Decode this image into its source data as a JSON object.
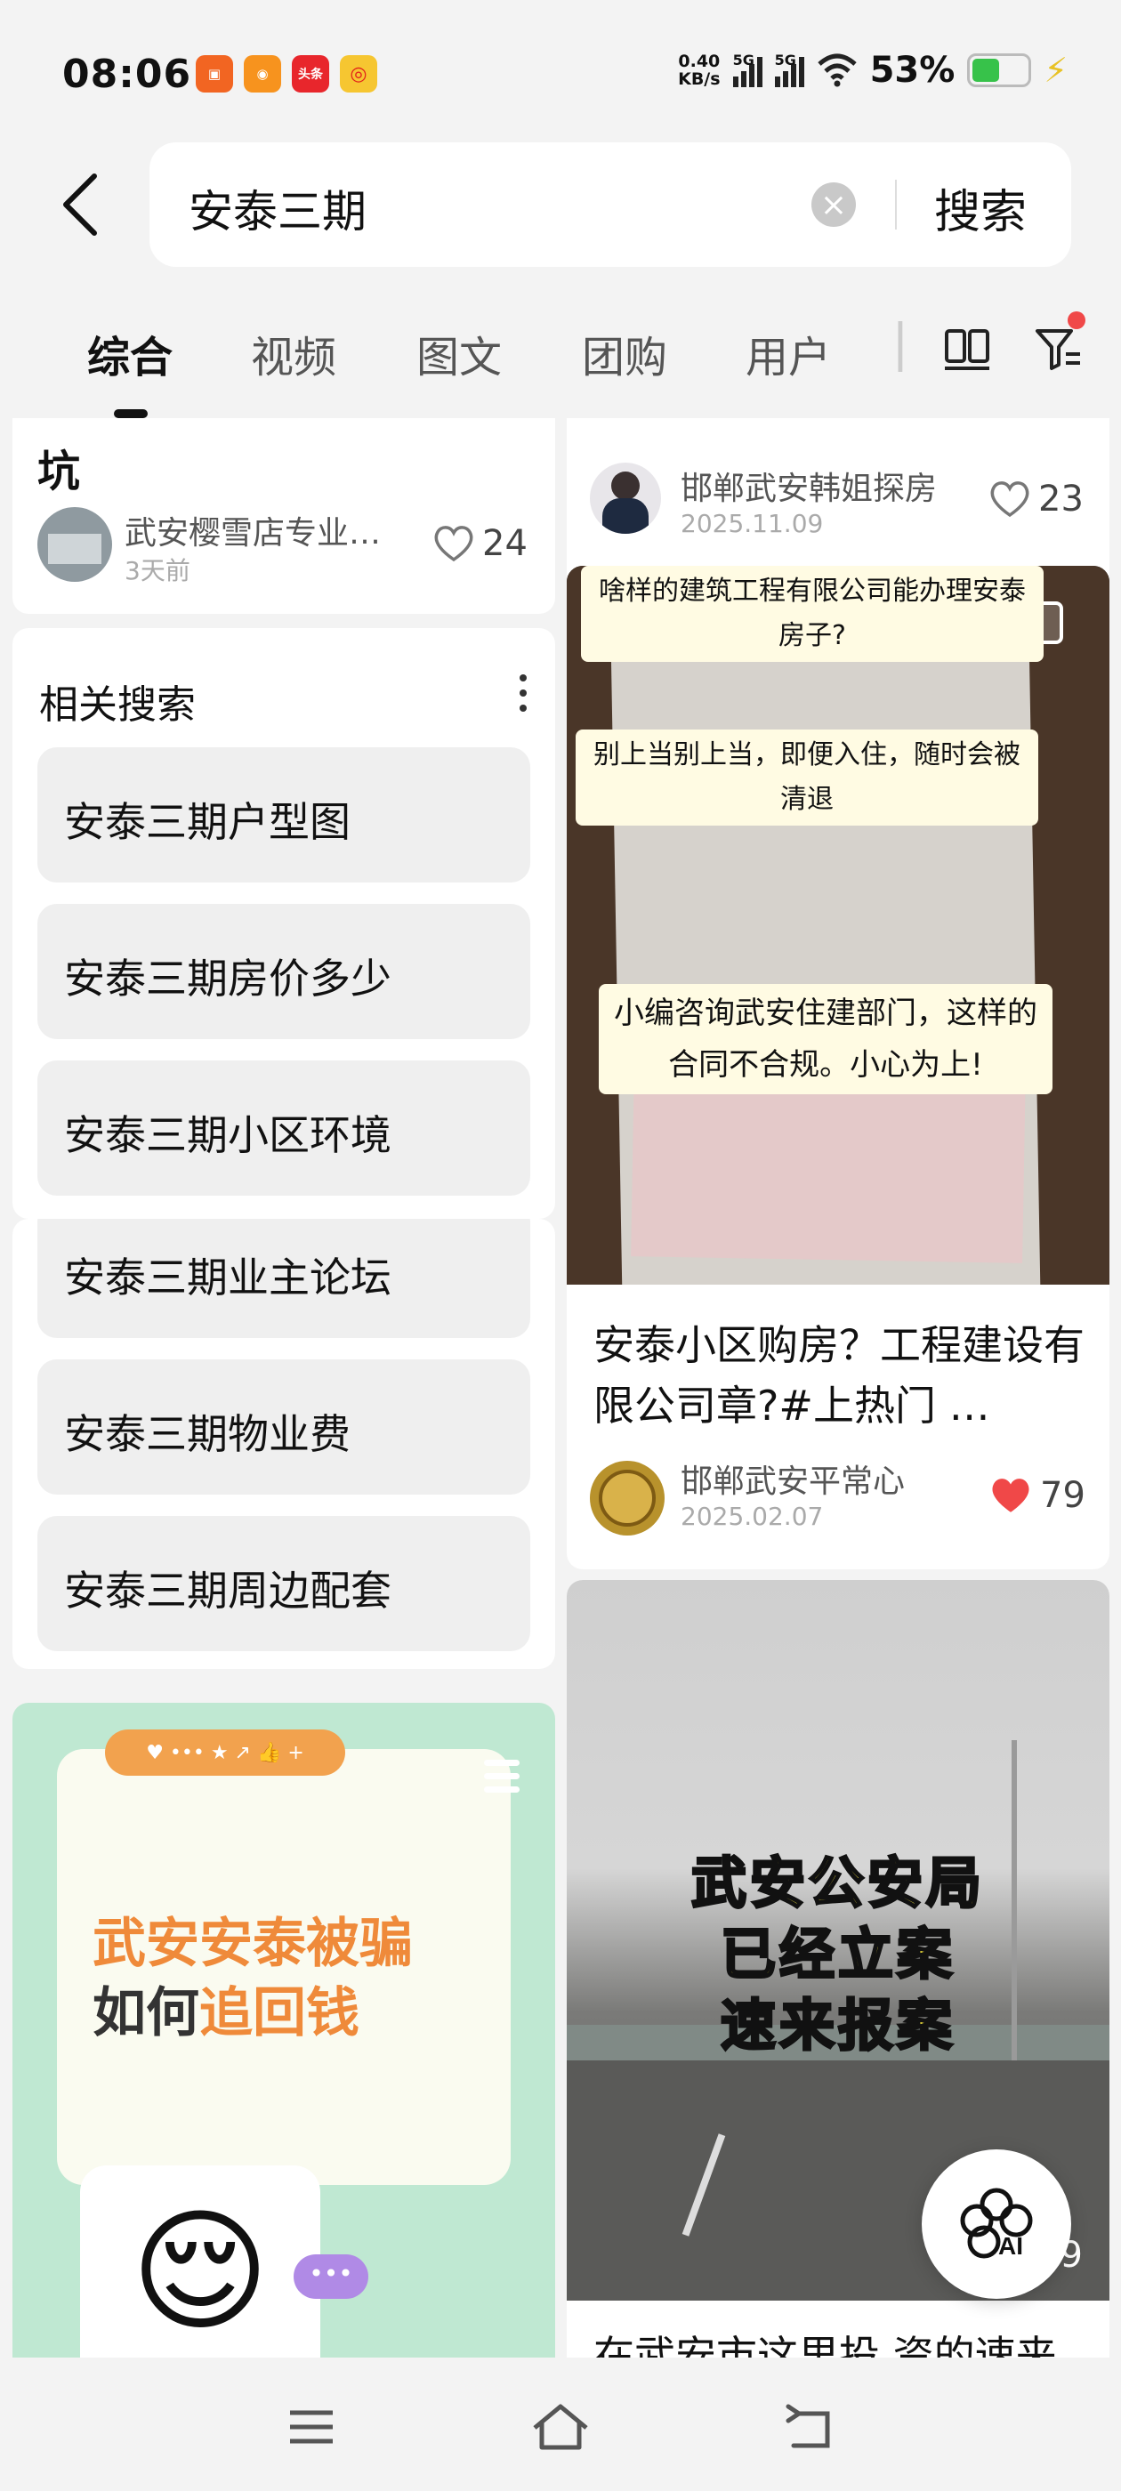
{
  "status_bar": {
    "time": "08:06",
    "net_speed_value": "0.40",
    "net_speed_unit": "KB/s",
    "sim1": "5G",
    "sim2": "5G",
    "battery": "53%",
    "app_icons": [
      "app-icon-1",
      "app-icon-2",
      "头条",
      "weibo-icon"
    ]
  },
  "search": {
    "query": "安泰三期",
    "submit_label": "搜索"
  },
  "tabs": [
    "综合",
    "视频",
    "图文",
    "团购",
    "用户"
  ],
  "left": {
    "card1": {
      "title_tail": "坑",
      "author": "武安樱雪店专业…",
      "date": "3天前",
      "likes": "24"
    },
    "related": {
      "title": "相关搜索",
      "items": [
        "安泰三期户型图",
        "安泰三期房价多少",
        "安泰三期小区环境",
        "安泰三期业主论坛",
        "安泰三期物业费",
        "安泰三期周边配套"
      ]
    },
    "promo": {
      "line1": "武安安泰被骗",
      "line2_prefix": "如何",
      "line2_highlight": "追回钱"
    }
  },
  "right": {
    "card1": {
      "author": "邯郸武安韩姐探房",
      "date": "2025.11.09",
      "likes": "23"
    },
    "card2": {
      "banner1": "啥样的建筑工程有限公司能办理安泰房子?",
      "banner2": "别上当别上当，即便入住，随时会被清退",
      "banner3": "小编咨询武安住建部门，这样的合同不合规。小心为上!",
      "title": "安泰小区购房？工程建设有限公司章?#上热门 …",
      "author": "邯郸武安平常心",
      "date": "2025.02.07",
      "likes": "79"
    },
    "card3": {
      "overlay": [
        "武安公安局",
        "已经立案",
        "速来报案"
      ],
      "title": "在武安市这里投 资的速来",
      "likes_partial": "9"
    }
  },
  "colors": {
    "accent_red": "#f04848",
    "promo_green": "#bfe8d2",
    "promo_orange": "#ef8a3a",
    "overlay_yellow": "#f3e33b"
  }
}
